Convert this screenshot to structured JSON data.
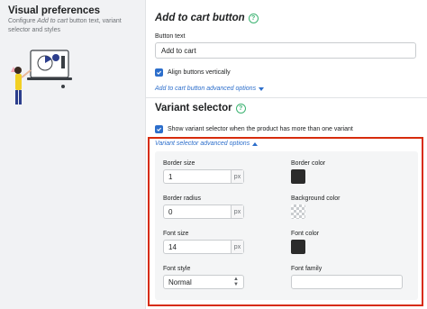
{
  "left": {
    "title": "Visual preferences",
    "desc_prefix": "Configure ",
    "desc_italic": "Add to cart",
    "desc_suffix": " button text, variant selector and styles"
  },
  "add_to_cart": {
    "title": "Add to cart button",
    "help": "?",
    "button_text_label": "Button text",
    "button_text_value": "Add to cart",
    "align_label": "Align buttons vertically",
    "advanced_link": "Add to cart button advanced options"
  },
  "variant": {
    "title": "Variant selector",
    "help": "?",
    "show_label": "Show variant selector when the product has more than one variant",
    "advanced_link": "Variant selector advanced options",
    "fields": {
      "border_size_label": "Border size",
      "border_size_value": "1",
      "border_radius_label": "Border radius",
      "border_radius_value": "0",
      "font_size_label": "Font size",
      "font_size_value": "14",
      "unit": "px",
      "font_style_label": "Font style",
      "font_style_value": "Normal",
      "border_color_label": "Border color",
      "background_color_label": "Background color",
      "font_color_label": "Font color",
      "font_family_label": "Font family",
      "font_family_value": ""
    }
  },
  "colors": {
    "accent": "#2c6ecb",
    "highlight": "#d72c0d",
    "help": "#3cb371",
    "border_color": "#2b2b2b",
    "font_color": "#2b2b2b"
  }
}
